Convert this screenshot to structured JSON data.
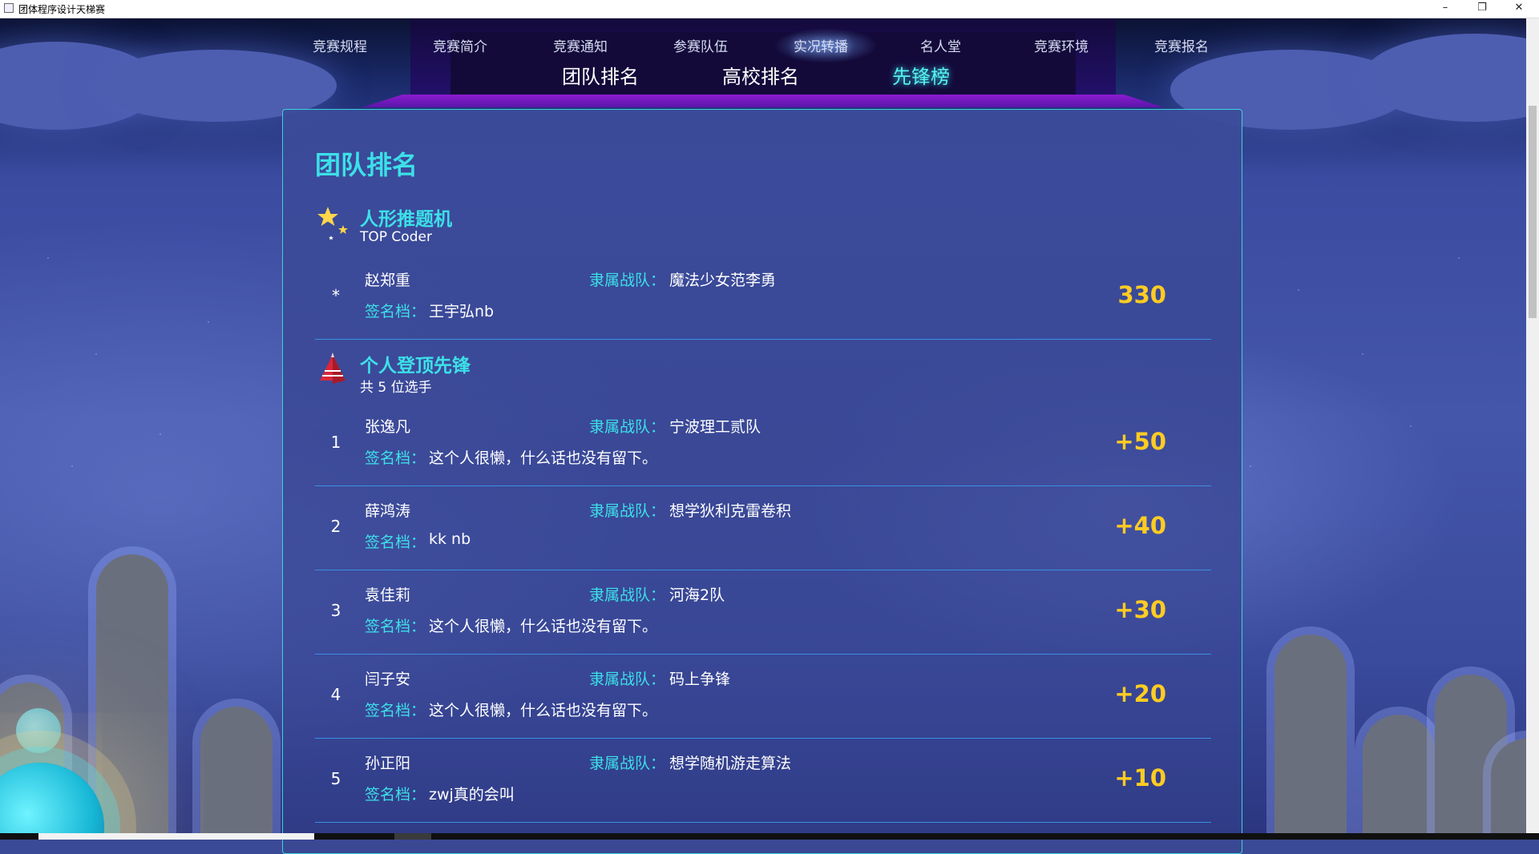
{
  "window": {
    "title": "团体程序设计天梯赛",
    "minimize": "–",
    "restore": "❐",
    "close": "✕"
  },
  "topnav": {
    "items": [
      {
        "label": "竞赛规程"
      },
      {
        "label": "竞赛简介"
      },
      {
        "label": "竞赛通知"
      },
      {
        "label": "参赛队伍"
      },
      {
        "label": "实况转播"
      },
      {
        "label": "名人堂"
      },
      {
        "label": "竞赛环境"
      },
      {
        "label": "竞赛报名"
      }
    ]
  },
  "subnav": {
    "tabs": [
      {
        "label": "团队排名"
      },
      {
        "label": "高校排名"
      },
      {
        "label": "先锋榜",
        "active": true
      }
    ]
  },
  "panel": {
    "title": "团队排名",
    "team_label": "隶属战队：",
    "sig_label": "签名档：",
    "top_coder": {
      "title": "人形推题机",
      "subtitle": "TOP Coder",
      "icon": "stars-icon",
      "entry": {
        "rank": "*",
        "name": "赵郑重",
        "team": "魔法少女范李勇",
        "signature": "王宇弘nb",
        "score": "330"
      }
    },
    "pioneers": {
      "title": "个人登顶先锋",
      "subtitle": "共 5 位选手",
      "icon": "pyramid-icon",
      "entries": [
        {
          "rank": "1",
          "name": "张逸凡",
          "team": "宁波理工贰队",
          "signature": "这个人很懒，什么话也没有留下。",
          "score": "+50"
        },
        {
          "rank": "2",
          "name": "薛鸿涛",
          "team": "想学狄利克雷卷积",
          "signature": "kk nb",
          "score": "+40"
        },
        {
          "rank": "3",
          "name": "袁佳莉",
          "team": "河海2队",
          "signature": "这个人很懒，什么话也没有留下。",
          "score": "+30"
        },
        {
          "rank": "4",
          "name": "闫子安",
          "team": "码上争锋",
          "signature": "这个人很懒，什么话也没有留下。",
          "score": "+20"
        },
        {
          "rank": "5",
          "name": "孙正阳",
          "team": "想学随机游走算法",
          "signature": "zwj真的会叫",
          "score": "+10"
        }
      ]
    }
  },
  "colors": {
    "accent": "#3ce0e8",
    "score": "#ffcc22",
    "background": "#3b4a96"
  }
}
